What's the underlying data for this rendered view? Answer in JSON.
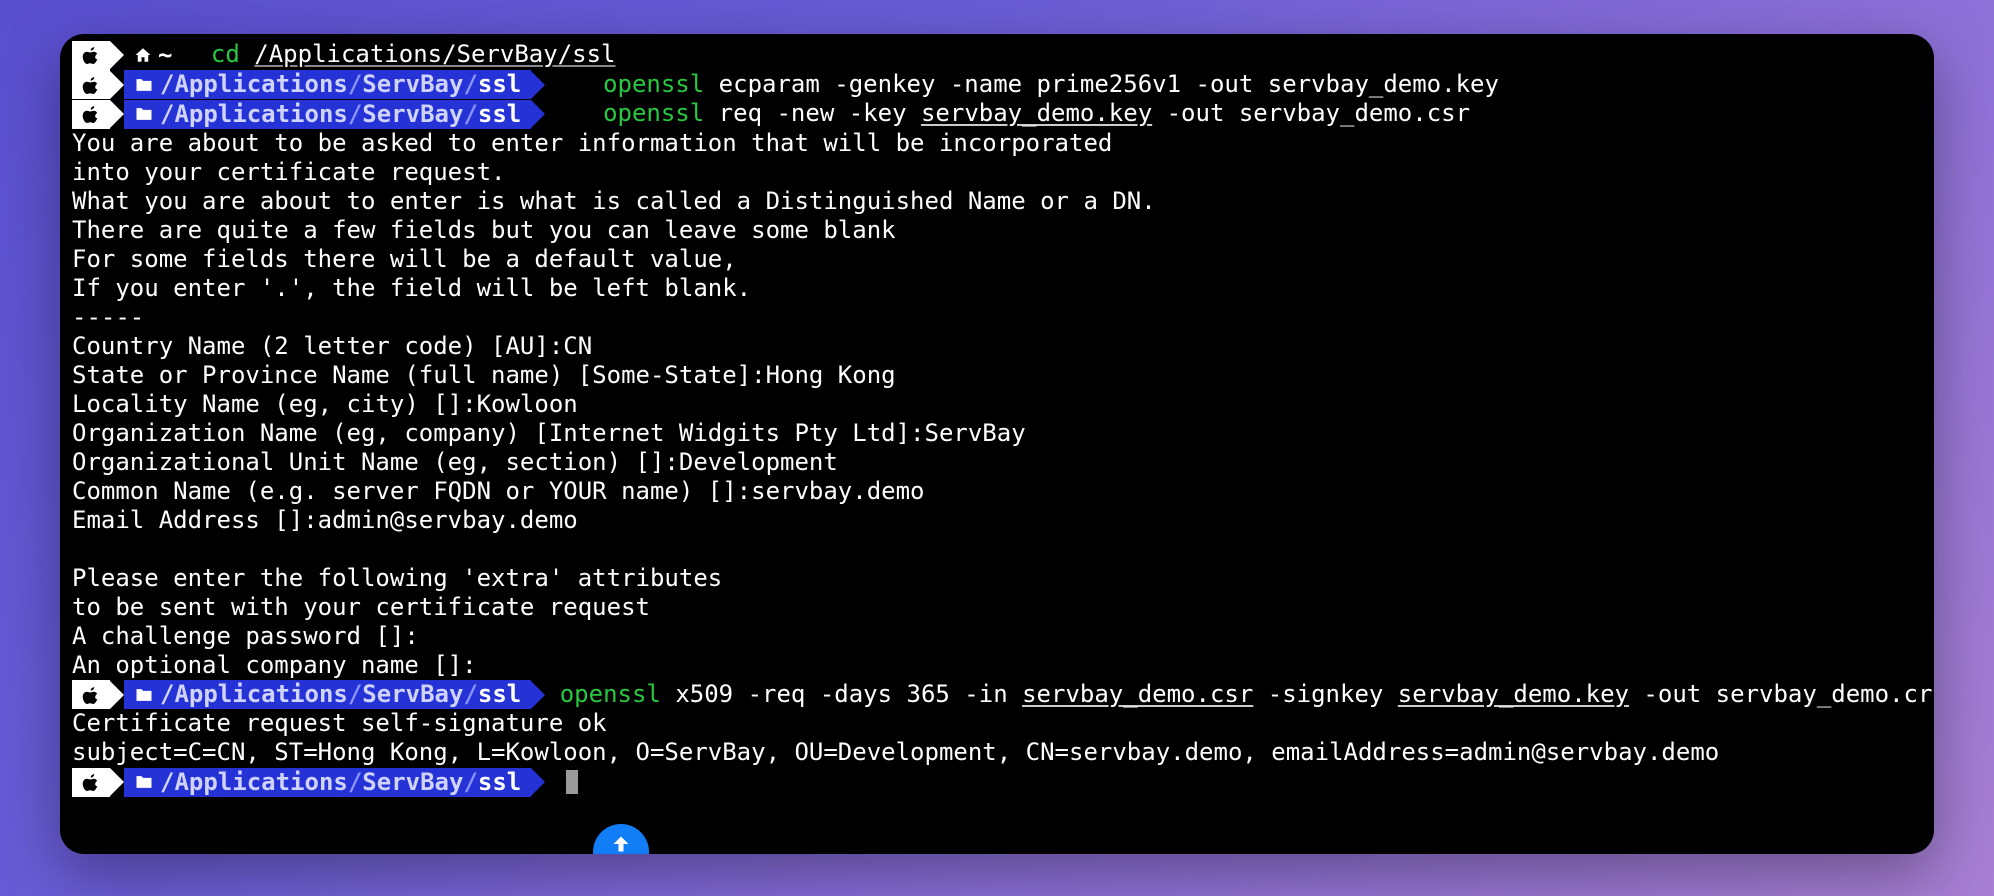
{
  "prompts": {
    "home": {
      "path": "~"
    },
    "ssl": {
      "parts": [
        "/Applications",
        "ServBay",
        "ssl"
      ]
    }
  },
  "commands": {
    "cd": {
      "bin": "cd",
      "arg": "/Applications/ServBay/ssl"
    },
    "ecparam": {
      "bin": "openssl",
      "args": "ecparam -genkey -name prime256v1 -out servbay_demo.key"
    },
    "req": {
      "bin": "openssl",
      "pre": "req -new -key ",
      "keyfile": "servbay_demo.key",
      "post": " -out servbay_demo.csr"
    },
    "x509": {
      "bin": "openssl",
      "p1": " x509 -req -days 365 -in ",
      "csr": "servbay_demo.csr",
      "p2": " -signkey ",
      "key": "servbay_demo.key",
      "p3": " -out servbay_demo.crt"
    }
  },
  "output": {
    "l1": "You are about to be asked to enter information that will be incorporated",
    "l2": "into your certificate request.",
    "l3": "What you are about to enter is what is called a Distinguished Name or a DN.",
    "l4": "There are quite a few fields but you can leave some blank",
    "l5": "For some fields there will be a default value,",
    "l6": "If you enter '.', the field will be left blank.",
    "l7": "-----",
    "l8": "Country Name (2 letter code) [AU]:CN",
    "l9": "State or Province Name (full name) [Some-State]:Hong Kong",
    "l10": "Locality Name (eg, city) []:Kowloon",
    "l11": "Organization Name (eg, company) [Internet Widgits Pty Ltd]:ServBay",
    "l12": "Organizational Unit Name (eg, section) []:Development",
    "l13": "Common Name (e.g. server FQDN or YOUR name) []:servbay.demo",
    "l14": "Email Address []:admin@servbay.demo",
    "l15": "Please enter the following 'extra' attributes",
    "l16": "to be sent with your certificate request",
    "l17": "A challenge password []:",
    "l18": "An optional company name []:",
    "l19": "Certificate request self-signature ok",
    "l20": "subject=C=CN, ST=Hong Kong, L=Kowloon, O=ServBay, OU=Development, CN=servbay.demo, emailAddress=admin@servbay.demo"
  }
}
